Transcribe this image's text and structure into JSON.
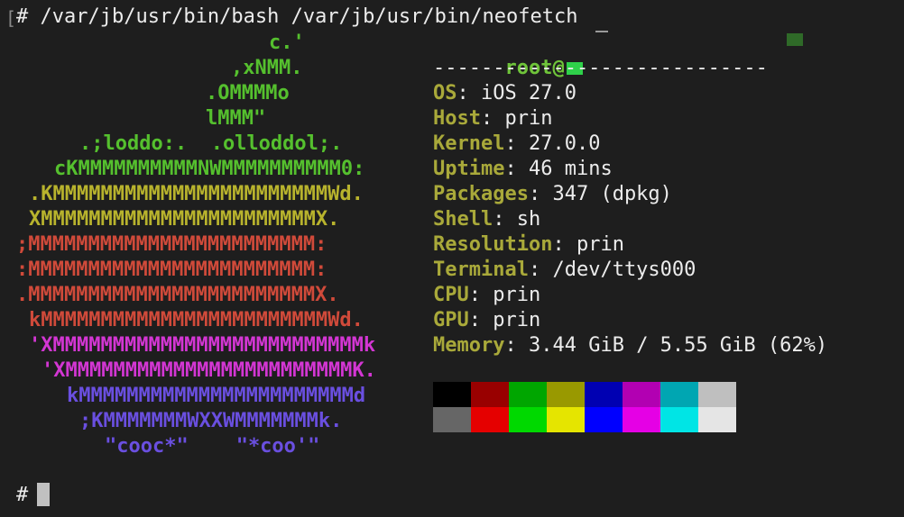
{
  "terminal": {
    "command_line": "# /var/jb/usr/bin/bash /var/jb/usr/bin/neofetch",
    "prompt": "#"
  },
  "logo": {
    "lines": [
      {
        "text": "c.'",
        "color": "#55c02e"
      },
      {
        "text": ",xNMM.",
        "color": "#55c02e"
      },
      {
        "text": ".OMMMMo",
        "color": "#55c02e"
      },
      {
        "text": "lMMM\"",
        "color": "#55c02e"
      },
      {
        "text": ".;loddo:.  .olloddol;.",
        "color": "#55c02e"
      },
      {
        "text": "cKMMMMMMMMMMNWMMMMMMMMMM0:",
        "color": "#55c02e"
      },
      {
        "text": ".KMMMMMMMMMMMMMMMMMMMMMMMWd.",
        "color": "#b8b32d"
      },
      {
        "text": "XMMMMMMMMMMMMMMMMMMMMMMMX.",
        "color": "#b8b32d"
      },
      {
        "text": ";MMMMMMMMMMMMMMMMMMMMMMMM:",
        "color": "#d04a3a"
      },
      {
        "text": ":MMMMMMMMMMMMMMMMMMMMMMMM:",
        "color": "#d04a3a"
      },
      {
        "text": ".MMMMMMMMMMMMMMMMMMMMMMMMX.",
        "color": "#d04a3a"
      },
      {
        "text": "kMMMMMMMMMMMMMMMMMMMMMMMMWd.",
        "color": "#d04a3a"
      },
      {
        "text": "'XMMMMMMMMMMMMMMMMMMMMMMMMMMk",
        "color": "#d336d3"
      },
      {
        "text": "'XMMMMMMMMMMMMMMMMMMMMMMMMK.",
        "color": "#d336d3"
      },
      {
        "text": "kMMMMMMMMMMMMMMMMMMMMMMMd",
        "color": "#6a4fe0"
      },
      {
        "text": ";KMMMMMMMWXXWMMMMMMMk.",
        "color": "#6a4fe0"
      },
      {
        "text": "\"cooc*\"    \"*coo'\"",
        "color": "#6a4fe0"
      }
    ]
  },
  "info": {
    "user": "root@",
    "separator": "----------------------------",
    "rows": [
      {
        "key": "OS",
        "value": "iOS 27.0"
      },
      {
        "key": "Host",
        "value": "prin"
      },
      {
        "key": "Kernel",
        "value": "27.0.0"
      },
      {
        "key": "Uptime",
        "value": "46 mins"
      },
      {
        "key": "Packages",
        "value": "347 (dpkg)"
      },
      {
        "key": "Shell",
        "value": "sh"
      },
      {
        "key": "Resolution",
        "value": "prin"
      },
      {
        "key": "Terminal",
        "value": "/dev/ttys000"
      },
      {
        "key": "CPU",
        "value": "prin"
      },
      {
        "key": "GPU",
        "value": "prin"
      },
      {
        "key": "Memory",
        "value": "3.44 GiB / 5.55 GiB (62%)"
      }
    ],
    "key_suffix": ": "
  },
  "palette": {
    "normal": [
      "#000000",
      "#990000",
      "#00a600",
      "#999900",
      "#0000b2",
      "#b200b2",
      "#00a6b2",
      "#bfbfbf"
    ],
    "bright": [
      "#666666",
      "#e50000",
      "#00d900",
      "#e5e500",
      "#0000ff",
      "#e500e5",
      "#00e5e5",
      "#e5e5e5"
    ]
  }
}
